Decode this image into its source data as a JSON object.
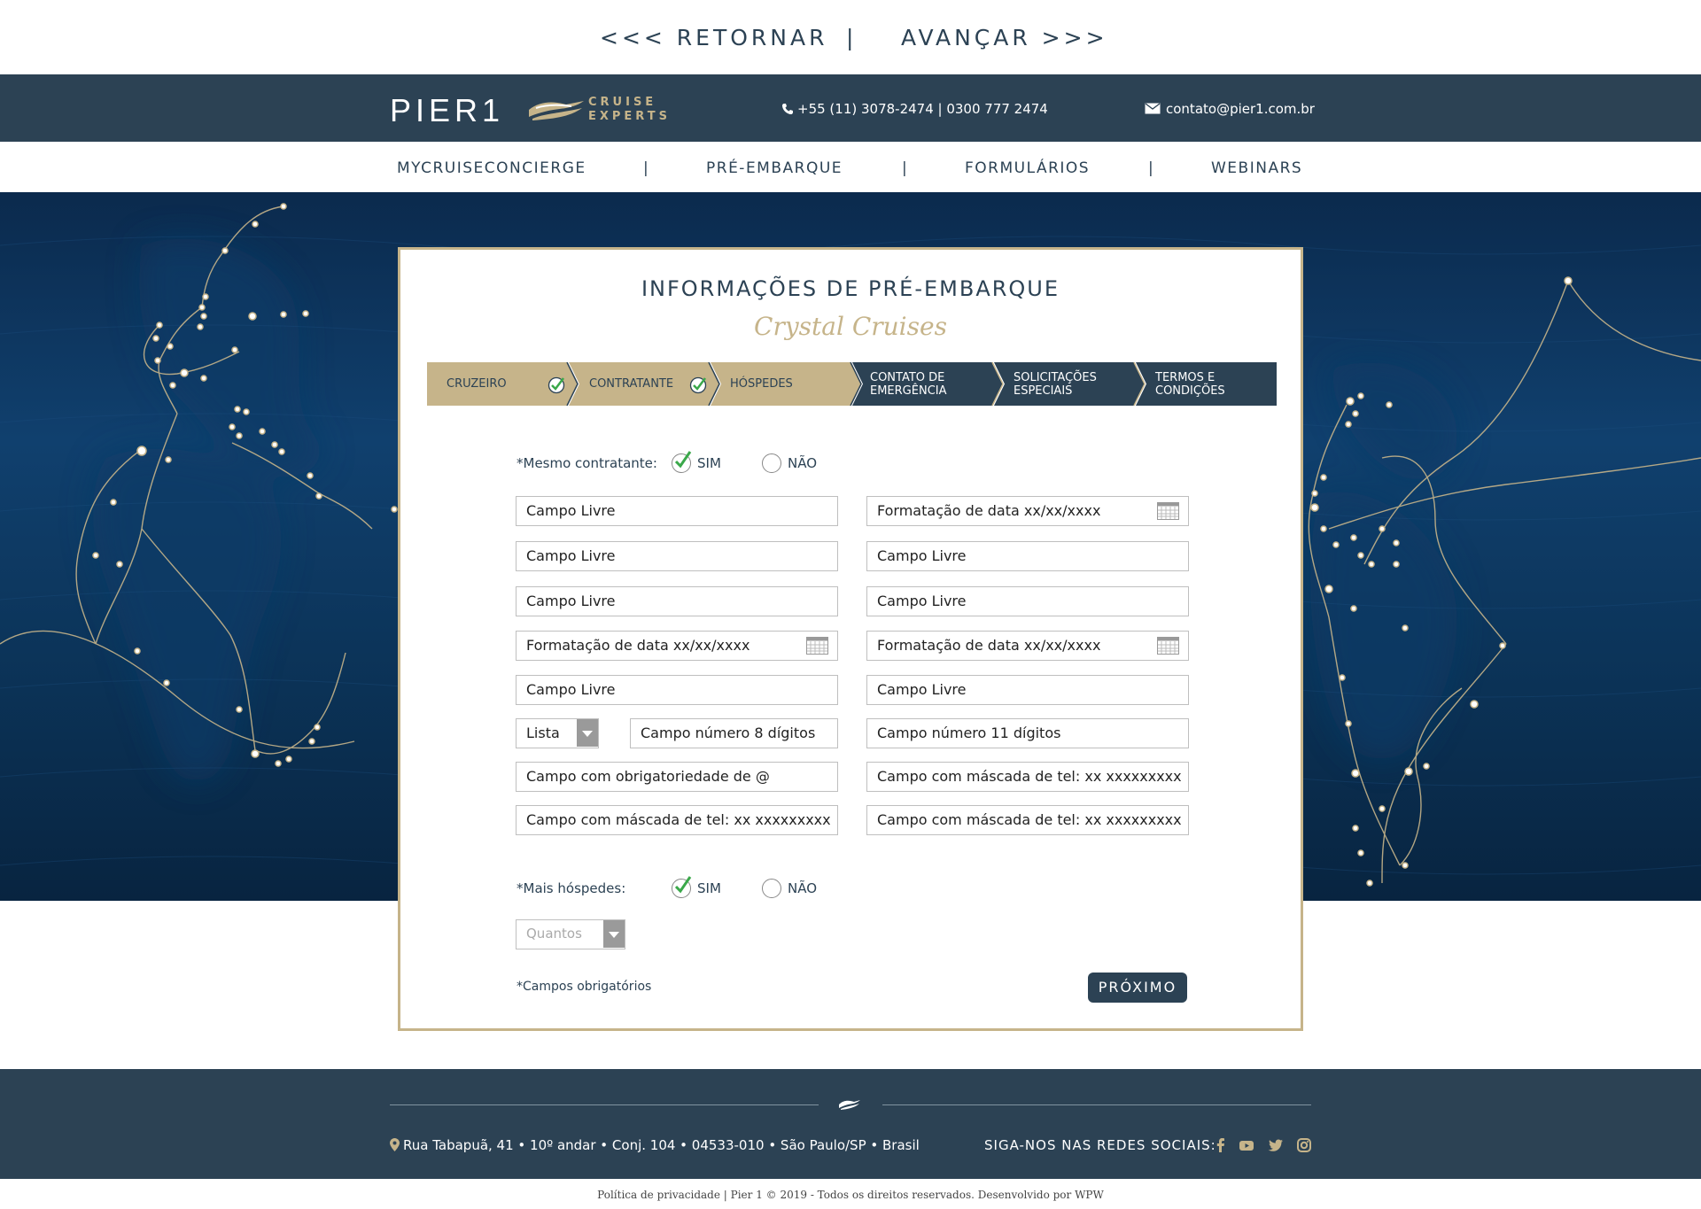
{
  "topnav": {
    "back": "<<< RETORNAR",
    "divider": "|",
    "forward": "AVANÇAR >>>"
  },
  "header": {
    "logo_main": "PIER1",
    "logo_sub_1": "CRUISE",
    "logo_sub_2": "EXPERTS",
    "phone": "+55 (11) 3078-2474  |  0300 777 2474",
    "email": "contato@pier1.com.br"
  },
  "mainnav": {
    "items": [
      "MYCRUISECONCIERGE",
      "PRÉ-EMBARQUE",
      "FORMULÁRIOS",
      "WEBINARS"
    ],
    "divider": "|"
  },
  "form": {
    "title": "INFORMAÇÕES DE PRÉ-EMBARQUE",
    "subtitle": "Crystal Cruises",
    "steps": [
      {
        "label": "CRUZEIRO",
        "done": true
      },
      {
        "label": "CONTRATANTE",
        "done": true
      },
      {
        "label": "HÓSPEDES",
        "done": false
      },
      {
        "label_1": "CONTATO DE",
        "label_2": "EMERGÊNCIA"
      },
      {
        "label_1": "SOLICITAÇÕES",
        "label_2": "ESPECIAIS"
      },
      {
        "label_1": "TERMOS E",
        "label_2": "CONDIÇÕES"
      }
    ],
    "same_contractor": {
      "label": "*Mesmo contratante:",
      "yes": "SIM",
      "no": "NÃO",
      "selected": "SIM"
    },
    "fields": {
      "l1": "Campo Livre",
      "r1": "Formatação de data xx/xx/xxxx",
      "l2": "Campo Livre",
      "r2": "Campo Livre",
      "l3": "Campo Livre",
      "r3": "Campo Livre",
      "l4": "Formatação de data xx/xx/xxxx",
      "r4": "Formatação de data xx/xx/xxxx",
      "l5": "Campo Livre",
      "r5": "Campo Livre",
      "l6_select": "Lista",
      "l6_num": "Campo número 8 dígitos",
      "r6": "Campo número 11 dígitos",
      "l7": "Campo com obrigatoriedade de @",
      "r7": "Campo com máscada de tel: xx xxxxxxxxx",
      "l8": "Campo com máscada de tel: xx xxxxxxxxx",
      "r8": "Campo com máscada de tel: xx xxxxxxxxx"
    },
    "more_guests": {
      "label": "*Mais hóspedes:",
      "yes": "SIM",
      "no": "NÃO",
      "selected": "SIM"
    },
    "quantity_placeholder": "Quantos",
    "required_note": "*Campos obrigatórios",
    "next_button": "PRÓXIMO"
  },
  "footer": {
    "address": "Rua Tabapuã, 41 • 10º andar • Conj. 104 • 04533-010 • São Paulo/SP • Brasil",
    "social_label": "SIGA-NOS NAS REDES SOCIAIS:",
    "social_icons": [
      "facebook-icon",
      "youtube-icon",
      "twitter-icon",
      "instagram-icon"
    ],
    "legal": "Política de privacidade | Pier 1 © 2019 - Todos os direitos reservados. Desenvolvido por WPW"
  },
  "colors": {
    "navy": "#2c4254",
    "gold": "#c6b48a",
    "check_green": "#3aa84a"
  }
}
